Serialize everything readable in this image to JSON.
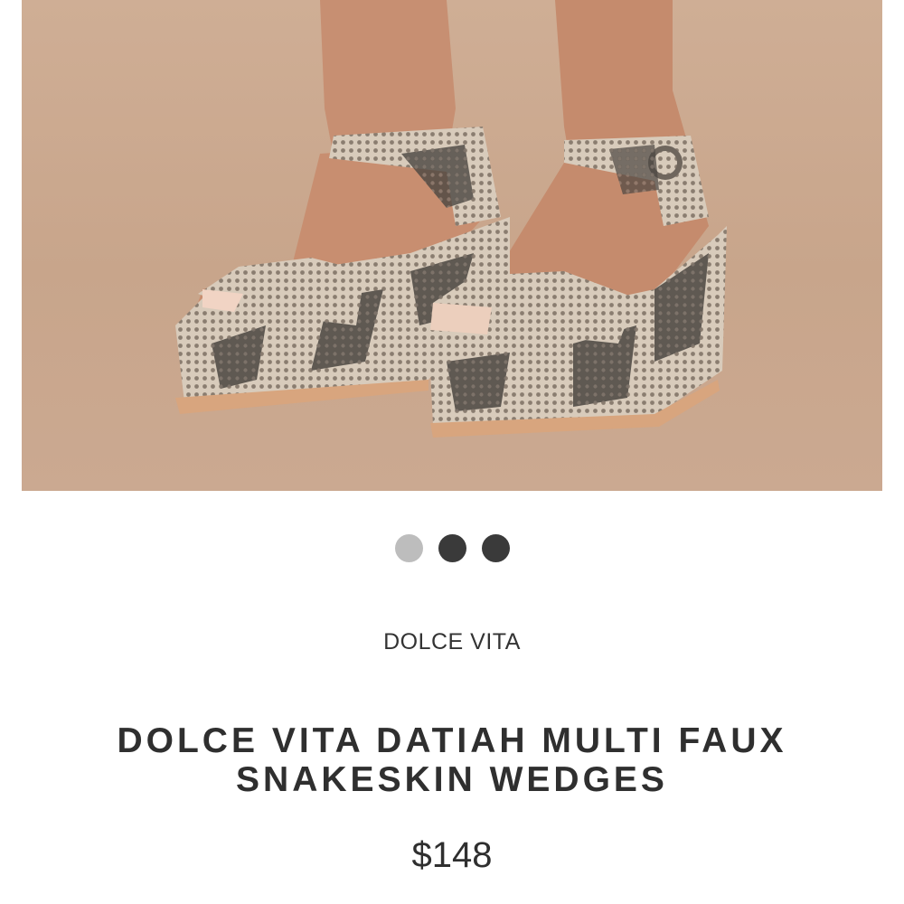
{
  "product": {
    "image_alt": "snakeskin platform wedge sandals",
    "brand": "DOLCE VITA",
    "title": "DOLCE VITA DATIAH MULTI FAUX SNAKESKIN WEDGES",
    "price": "$148"
  },
  "carousel": {
    "dots": [
      {
        "state": "active"
      },
      {
        "state": "inactive"
      },
      {
        "state": "inactive"
      }
    ]
  },
  "colors": {
    "backdrop": "#c9a68c",
    "text": "#333333",
    "dot_active": "#bdbdbd",
    "dot_inactive": "#3a3a3a"
  }
}
